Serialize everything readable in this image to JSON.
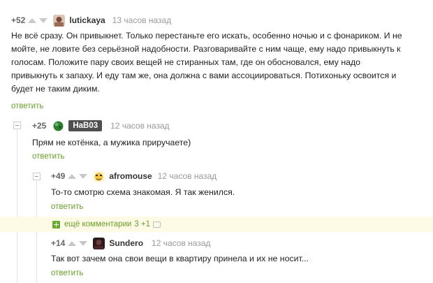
{
  "comments": [
    {
      "rating": "+52",
      "username": "lutickaya",
      "time": "13 часов назад",
      "lines": [
        "Не всё сразу. Он привыкнет. Только перестаньте его искать, особенно ночью и с фонариком. И не",
        "мойте, не ловите без серьёзной надобности. Разговаривайте с ним чаще, ему надо привыкнуть к",
        "голосам. Положите пару своих вещей не стиранных там, где он обосновался, ему надо",
        "привыкнуть к запаху. И еду там же, она должна с вами ассоциироваться. Потихоньку освоится и",
        "будет не таким диким."
      ],
      "reply_label": "ответить"
    },
    {
      "rating": "+25",
      "username": "HaB03",
      "time": "12 часов назад",
      "text": "Прям не котёнка, а мужика приручаете)",
      "reply_label": "ответить"
    },
    {
      "rating": "+49",
      "username": "afromouse",
      "time": "12 часов назад",
      "text": "То-то смотрю схема знакомая. Я так женился.",
      "reply_label": "ответить"
    },
    {
      "rating": "+14",
      "username": "Sundero",
      "time": "12 часов назад",
      "text": "Так вот зачем она свои вещи в квартиру принела и их не носит...",
      "reply_label": "ответить"
    }
  ],
  "more_comments": {
    "label": "ещё комментарии",
    "count": "3 +1"
  },
  "colors": {
    "reply_green": "#6a9e29",
    "more_bg": "#fdfbe6",
    "badge_bg": "#4f4f4f"
  }
}
